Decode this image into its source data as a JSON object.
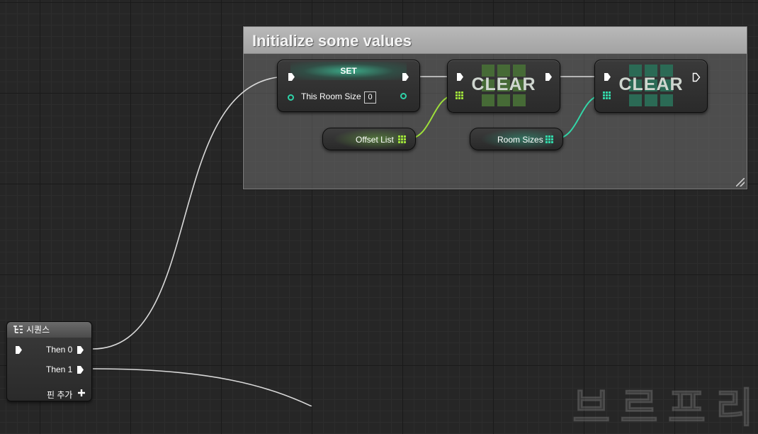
{
  "comment": {
    "title": "Initialize some values"
  },
  "set_node": {
    "header": "SET",
    "pin_label": "This Room Size",
    "value": "0"
  },
  "clear_nodes": [
    {
      "label": "CLEAR"
    },
    {
      "label": "CLEAR"
    }
  ],
  "variables": {
    "offset_list": "Offset List",
    "room_sizes": "Room Sizes"
  },
  "sequence_node": {
    "title": "시퀀스",
    "pins": [
      "Then 0",
      "Then 1"
    ],
    "add_pin": "핀 추가"
  },
  "watermark": "브르프리E",
  "colors": {
    "exec_wire": "#d9d9d9",
    "array_green": "#9ee03a",
    "array_teal": "#33d6a8",
    "integer_pin": "#2ed3a8",
    "comment_title_bg": "#b0b0b0"
  }
}
